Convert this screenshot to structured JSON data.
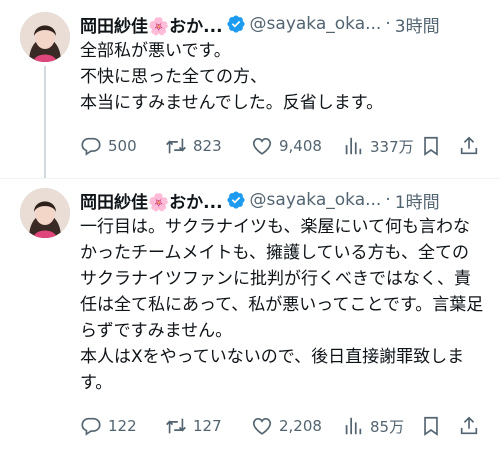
{
  "tweets": [
    {
      "author": {
        "name": "岡田紗佳🌸おか...",
        "handle": "@sayaka_oka...",
        "avatar_icon": "profile-photo",
        "verified_icon": "verified-badge-icon"
      },
      "time": "3時間",
      "separator": "·",
      "text": [
        "全部私が悪いです。",
        "不快に思った全ての方、",
        "本当にすみませんでした。反省します。"
      ],
      "actions": {
        "reply": "500",
        "retweet": "823",
        "like": "9,408",
        "views": "337万"
      }
    },
    {
      "author": {
        "name": "岡田紗佳🌸おか...",
        "handle": "@sayaka_oka...",
        "avatar_icon": "profile-photo",
        "verified_icon": "verified-badge-icon"
      },
      "time": "1時間",
      "separator": "·",
      "text": [
        "一行目は。サクラナイツも、楽屋にいて何も言わなかったチームメイトも、擁護している方も、全てのサクラナイツファンに批判が行くべきではなく、責任は全て私にあって、私が悪いってことです。言葉足らずですみません。",
        "本人はXをやっていないので、後日直接謝罪致します。"
      ],
      "actions": {
        "reply": "122",
        "retweet": "127",
        "like": "2,208",
        "views": "85万"
      }
    }
  ],
  "colors": {
    "text": "#0f1419",
    "secondary": "#536471",
    "verified": "#1d9bf0",
    "thread_line": "#cfd9de"
  }
}
